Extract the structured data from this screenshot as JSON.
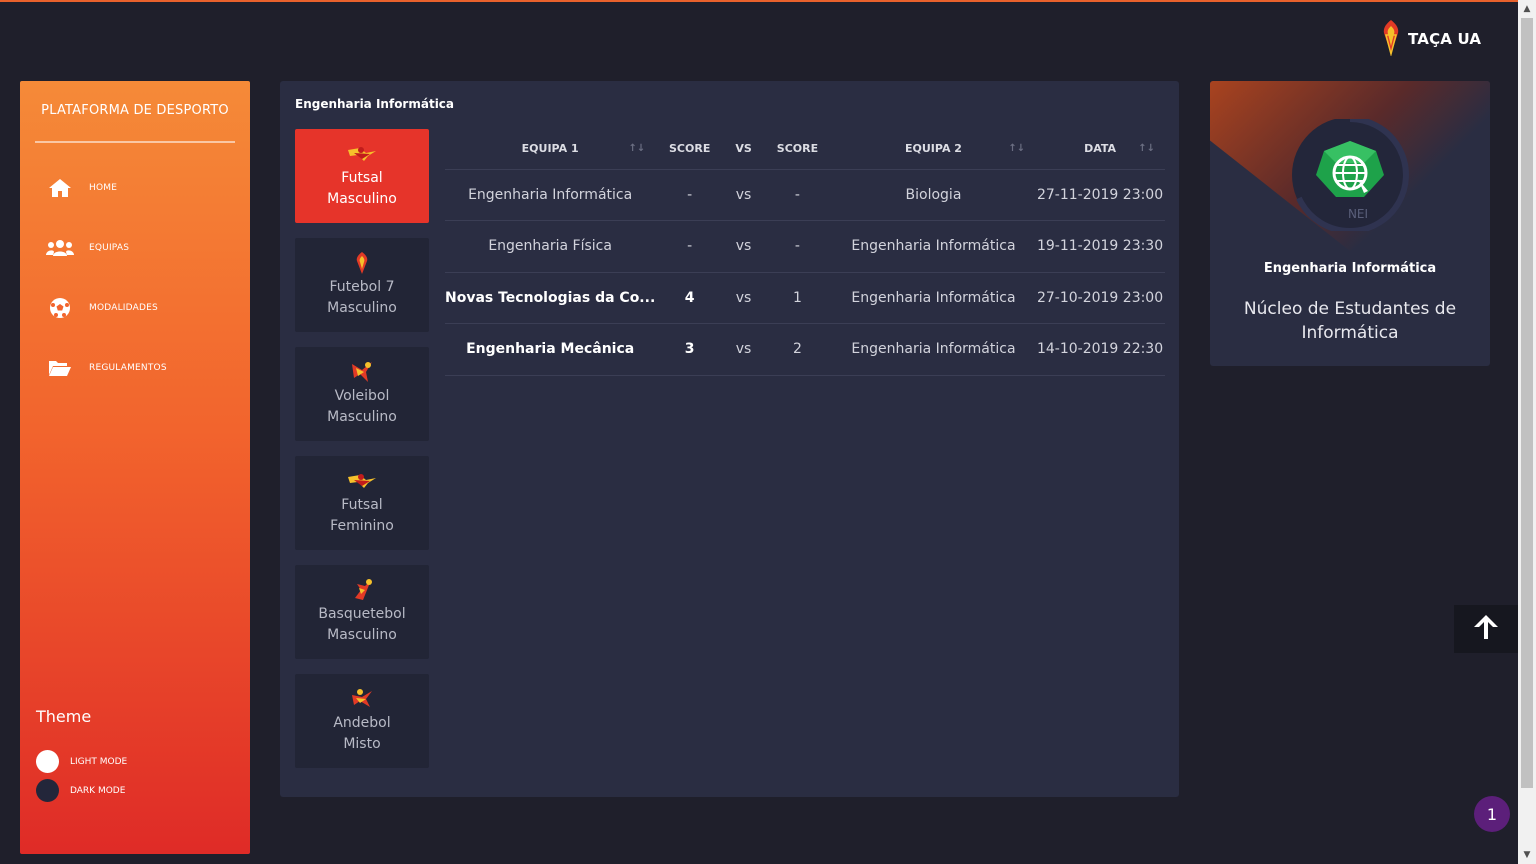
{
  "brand": {
    "name": "TAÇA UA",
    "icon": "torch-logo-icon"
  },
  "sidebar": {
    "title": "PLATAFORMA DE DESPORTO",
    "items": [
      {
        "label": "HOME",
        "icon": "home-icon"
      },
      {
        "label": "EQUIPAS",
        "icon": "users-icon"
      },
      {
        "label": "MODALIDADES",
        "icon": "soccer-ball-icon"
      },
      {
        "label": "REGULAMENTOS",
        "icon": "folder-open-icon"
      }
    ],
    "theme": {
      "title": "Theme",
      "light": "LIGHT MODE",
      "dark": "DARK MODE"
    }
  },
  "main": {
    "title": "Engenharia Informática",
    "sports": [
      {
        "line1": "Futsal",
        "line2": "Masculino",
        "active": true
      },
      {
        "line1": "Futebol 7",
        "line2": "Masculino",
        "active": false
      },
      {
        "line1": "Voleibol",
        "line2": "Masculino",
        "active": false
      },
      {
        "line1": "Futsal",
        "line2": "Feminino",
        "active": false
      },
      {
        "line1": "Basquetebol",
        "line2": "Masculino",
        "active": false
      },
      {
        "line1": "Andebol",
        "line2": "Misto",
        "active": false
      }
    ],
    "table": {
      "headers": {
        "team1": "EQUIPA 1",
        "score1": "SCORE",
        "vs": "VS",
        "score2": "SCORE",
        "team2": "EQUIPA 2",
        "date": "DATA",
        "sort": "↑↓"
      },
      "rows": [
        {
          "team1": "Engenharia Informática",
          "score1": "-",
          "vs": "vs",
          "score2": "-",
          "team2": "Biologia",
          "date": "27-11-2019 23:00"
        },
        {
          "team1": "Engenharia Física",
          "score1": "-",
          "vs": "vs",
          "score2": "-",
          "team2": "Engenharia Informática",
          "date": "19-11-2019 23:30"
        },
        {
          "team1": "Novas Tecnologias da Co...",
          "score1": "4",
          "vs": "vs",
          "score2": "1",
          "team2": "Engenharia Informática",
          "date": "27-10-2019 23:00"
        },
        {
          "team1": "Engenharia Mecânica",
          "score1": "3",
          "vs": "vs",
          "score2": "2",
          "team2": "Engenharia Informática",
          "date": "14-10-2019 22:30"
        }
      ]
    }
  },
  "team_card": {
    "logo_text": "NEI",
    "name": "Engenharia Informática",
    "subtitle": "Núcleo de Estudantes de Informática"
  },
  "notification": {
    "count": "1"
  },
  "colors": {
    "accent": "#f2642d",
    "active_card": "#e6342a",
    "panel": "#2a2d42",
    "background": "#1f1f2b"
  }
}
